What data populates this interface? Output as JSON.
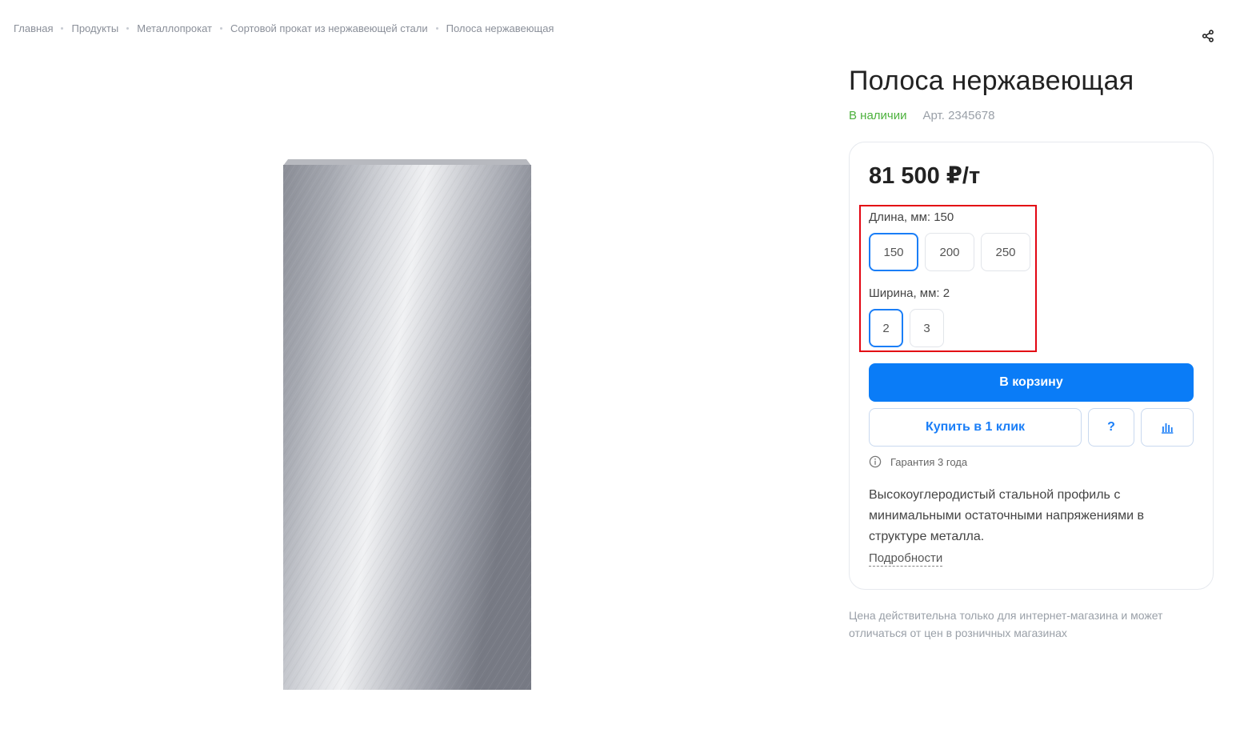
{
  "breadcrumb": [
    {
      "label": "Главная"
    },
    {
      "label": "Продукты"
    },
    {
      "label": "Металлопрокат"
    },
    {
      "label": "Сортовой прокат из нержавеющей стали"
    },
    {
      "label": "Полоса нержавеющая"
    }
  ],
  "product": {
    "title": "Полоса нержавеющая",
    "availability": "В наличии",
    "sku": "Арт. 2345678",
    "price": "81 500 ₽/т"
  },
  "options": {
    "length": {
      "label": "Длина, мм: 150",
      "values": [
        "150",
        "200",
        "250"
      ],
      "selected": "150"
    },
    "width": {
      "label": "Ширина, мм: 2",
      "values": [
        "2",
        "3"
      ],
      "selected": "2"
    }
  },
  "actions": {
    "add_to_cart": "В корзину",
    "buy_one_click": "Купить в 1 клик",
    "question": "?"
  },
  "warranty": "Гарантия 3 года",
  "description": "Высокоуглеродистый стальной профиль с минимальными остаточными напряжениями в структуре металла.",
  "details_link": "Подробности",
  "note": "Цена действительна только для интернет-магазина и может отличаться от цен в розничных магазинах",
  "colors": {
    "primary": "#0a7cf7",
    "in_stock": "#4cb13c",
    "highlight": "#e30613"
  }
}
